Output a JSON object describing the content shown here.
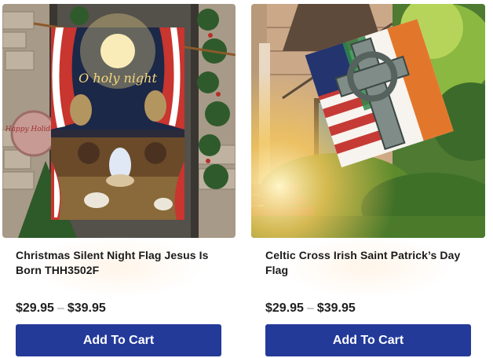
{
  "products": [
    {
      "title": "Christmas Silent Night Flag Jesus Is Born THH3502F",
      "price_low": "$29.95",
      "price_sep": "–",
      "price_high": "$39.95",
      "button_label": "Add To Cart",
      "image_icon": "nativity-flag-image",
      "flag_text": "O holy night",
      "sign_text": "Happy Holidays"
    },
    {
      "title": "Celtic Cross Irish Saint Patrick’s Day Flag",
      "price_low": "$29.95",
      "price_sep": "–",
      "price_high": "$39.95",
      "button_label": "Add To Cart",
      "image_icon": "celtic-cross-flag-image"
    }
  ],
  "colors": {
    "button_bg": "#233a99",
    "button_text": "#ffffff",
    "price_text": "#1f1f1f"
  }
}
